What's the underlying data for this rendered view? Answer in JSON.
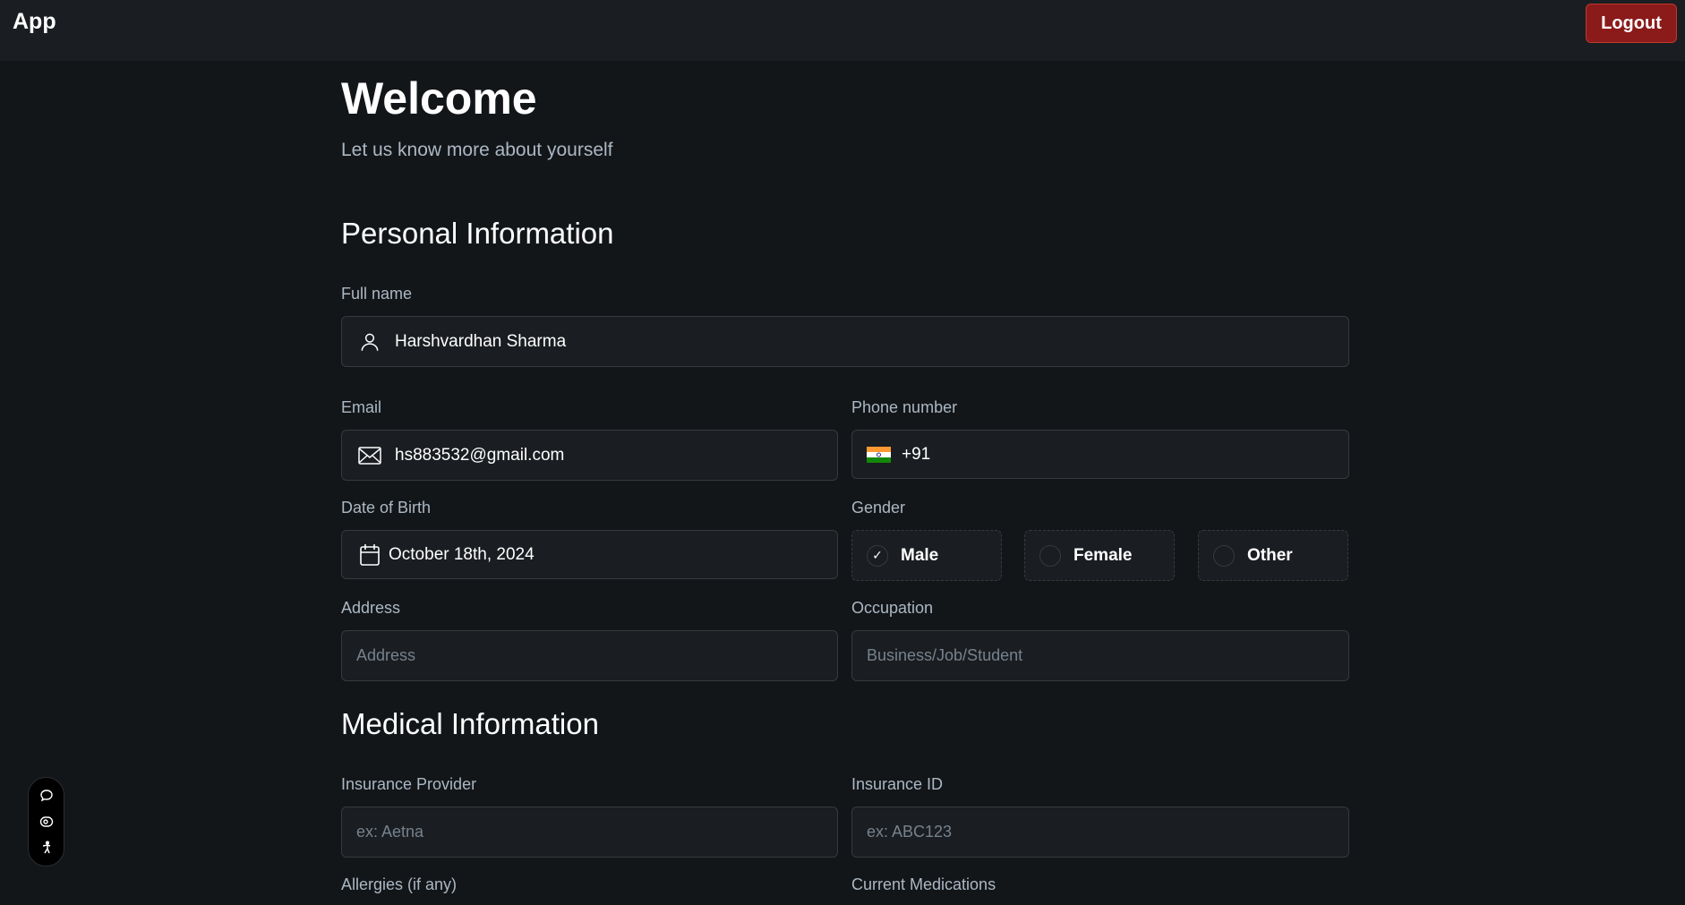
{
  "header": {
    "brand": "App",
    "logout_label": "Logout"
  },
  "intro": {
    "title": "Welcome",
    "subtitle": "Let us know more about yourself"
  },
  "personal": {
    "title": "Personal Information",
    "full_name": {
      "label": "Full name",
      "value": "Harshvardhan Sharma",
      "icon": "user-icon"
    },
    "email": {
      "label": "Email",
      "value": "hs883532@gmail.com",
      "icon": "mail-icon"
    },
    "phone": {
      "label": "Phone number",
      "value": "+91",
      "flag": "india-flag-icon"
    },
    "dob": {
      "label": "Date of Birth",
      "value": "October 18th, 2024",
      "icon": "calendar-icon"
    },
    "gender": {
      "label": "Gender",
      "options": [
        "Male",
        "Female",
        "Other"
      ],
      "selected": "Male"
    },
    "address": {
      "label": "Address",
      "placeholder": "Address"
    },
    "occupation": {
      "label": "Occupation",
      "placeholder": "Business/Job/Student"
    }
  },
  "medical": {
    "title": "Medical Information",
    "insurance_provider": {
      "label": "Insurance Provider",
      "placeholder": "ex: Aetna"
    },
    "insurance_id": {
      "label": "Insurance ID",
      "placeholder": "ex: ABC123"
    },
    "allergies": {
      "label": "Allergies (if any)"
    },
    "medications": {
      "label": "Current Medications"
    }
  },
  "side_tools": [
    "chat-icon",
    "eye-icon",
    "accessibility-icon"
  ],
  "colors": {
    "background": "#131619",
    "header": "#1a1d21",
    "field": "#1a1d21",
    "border": "#363a3d",
    "logout": "#8b1a1a",
    "muted": "#abb8c4",
    "placeholder": "#76828d"
  }
}
